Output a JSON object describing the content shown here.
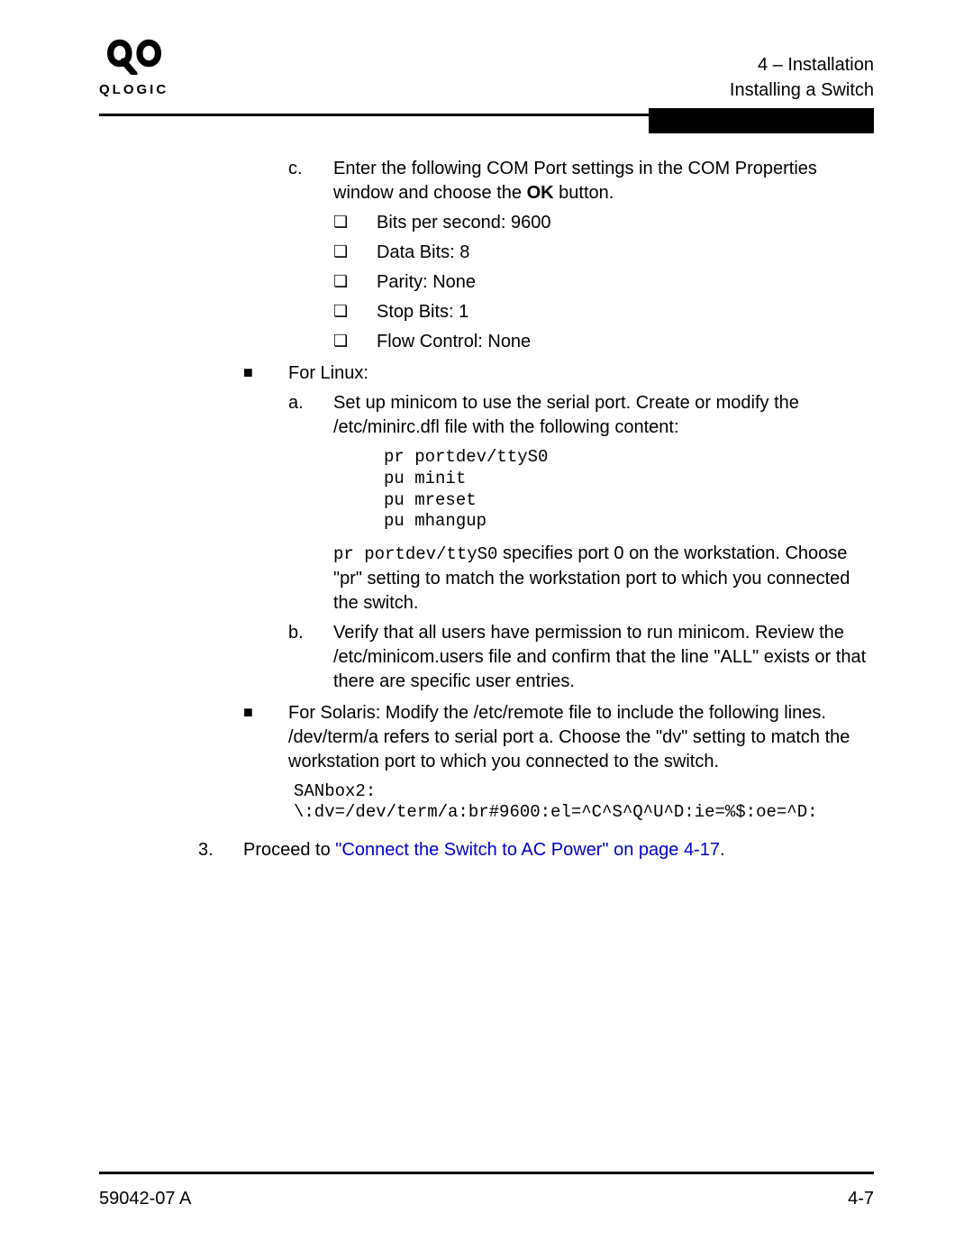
{
  "logo_text": "QLOGIC",
  "header": {
    "line1": "4 – Installation",
    "line2": "Installing a Switch"
  },
  "step_c": {
    "marker": "c.",
    "text_before_ok": "Enter the following COM Port settings in the COM Properties window and choose the ",
    "ok": "OK",
    "text_after_ok": " button.",
    "items": [
      "Bits per second: 9600",
      "Data Bits: 8",
      "Parity: None",
      "Stop Bits: 1",
      "Flow Control: None"
    ]
  },
  "linux": {
    "label": "For Linux:",
    "a": {
      "marker": "a.",
      "text": "Set up minicom to use the serial port. Create or modify the /etc/minirc.dfl file with the following content:",
      "code": "pr portdev/ttyS0\npu minit\npu mreset\npu mhangup",
      "note_code": "pr portdev/ttyS0",
      "note_tail": " specifies port 0 on the workstation. Choose \"pr\" setting to match the workstation port to which you connected the switch."
    },
    "b": {
      "marker": "b.",
      "text": "Verify that all users have permission to run minicom. Review the /etc/minicom.users file and confirm that the line \"ALL\" exists or that there are specific user entries."
    }
  },
  "solaris": {
    "text": "For Solaris: Modify the /etc/remote file to include the following lines. /dev/term/a refers to serial port a. Choose the \"dv\" setting to match the workstation port to which you connected to the switch.",
    "code": "SANbox2:\n\\:dv=/dev/term/a:br#9600:el=^C^S^Q^U^D:ie=%$:oe=^D:"
  },
  "step3": {
    "marker": "3.",
    "lead": "Proceed to ",
    "link": "\"Connect the Switch to AC Power\" on page 4-17",
    "tail": "."
  },
  "footer": {
    "left": "59042-07 A",
    "right": "4-7"
  }
}
